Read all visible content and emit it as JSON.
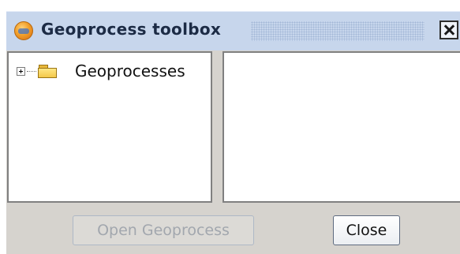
{
  "window": {
    "title": "Geoprocess toolbox",
    "app_icon": "gvsig-globe-icon",
    "close_icon": "close-icon"
  },
  "tree": {
    "items": [
      {
        "label": "Geoprocesses",
        "icon": "folder-icon",
        "expander": "plus"
      }
    ]
  },
  "buttons": {
    "open_label": "Open Geoprocess",
    "open_enabled": false,
    "close_label": "Close"
  },
  "colors": {
    "titlebar": "#c7d6ec",
    "panel_bg": "#d6d3ce",
    "border": "#808080"
  }
}
